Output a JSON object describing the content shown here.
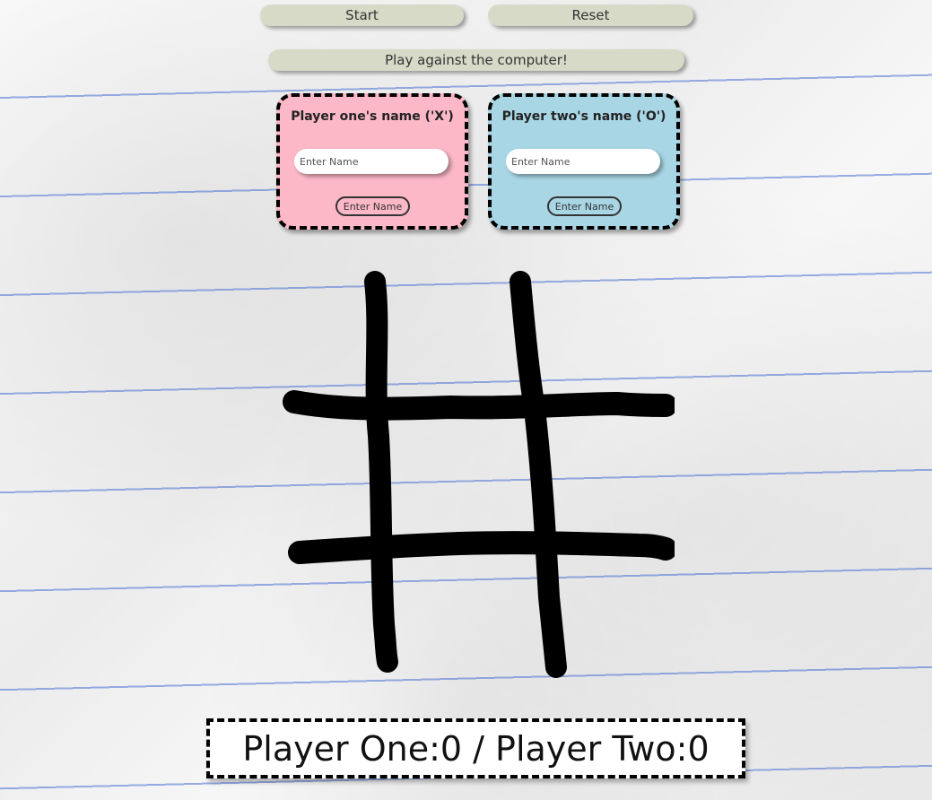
{
  "controls": {
    "start_label": "Start",
    "reset_label": "Reset",
    "computer_label": "Play against the computer!"
  },
  "player_one": {
    "title": "Player one's name ('X')",
    "input_placeholder": "Enter Name",
    "input_value": "",
    "button_label": "Enter Name",
    "card_color": "#fcb8c7"
  },
  "player_two": {
    "title": "Player two's name ('O')",
    "input_placeholder": "Enter Name",
    "input_value": "",
    "button_label": "Enter Name",
    "card_color": "#a9d6e5"
  },
  "board": {
    "cells": [
      "",
      "",
      "",
      "",
      "",
      "",
      "",
      "",
      ""
    ]
  },
  "score": {
    "player_one_label": "Player One:",
    "player_one_score": "0",
    "separator": " / ",
    "player_two_label": "Player Two:",
    "player_two_score": "0"
  }
}
